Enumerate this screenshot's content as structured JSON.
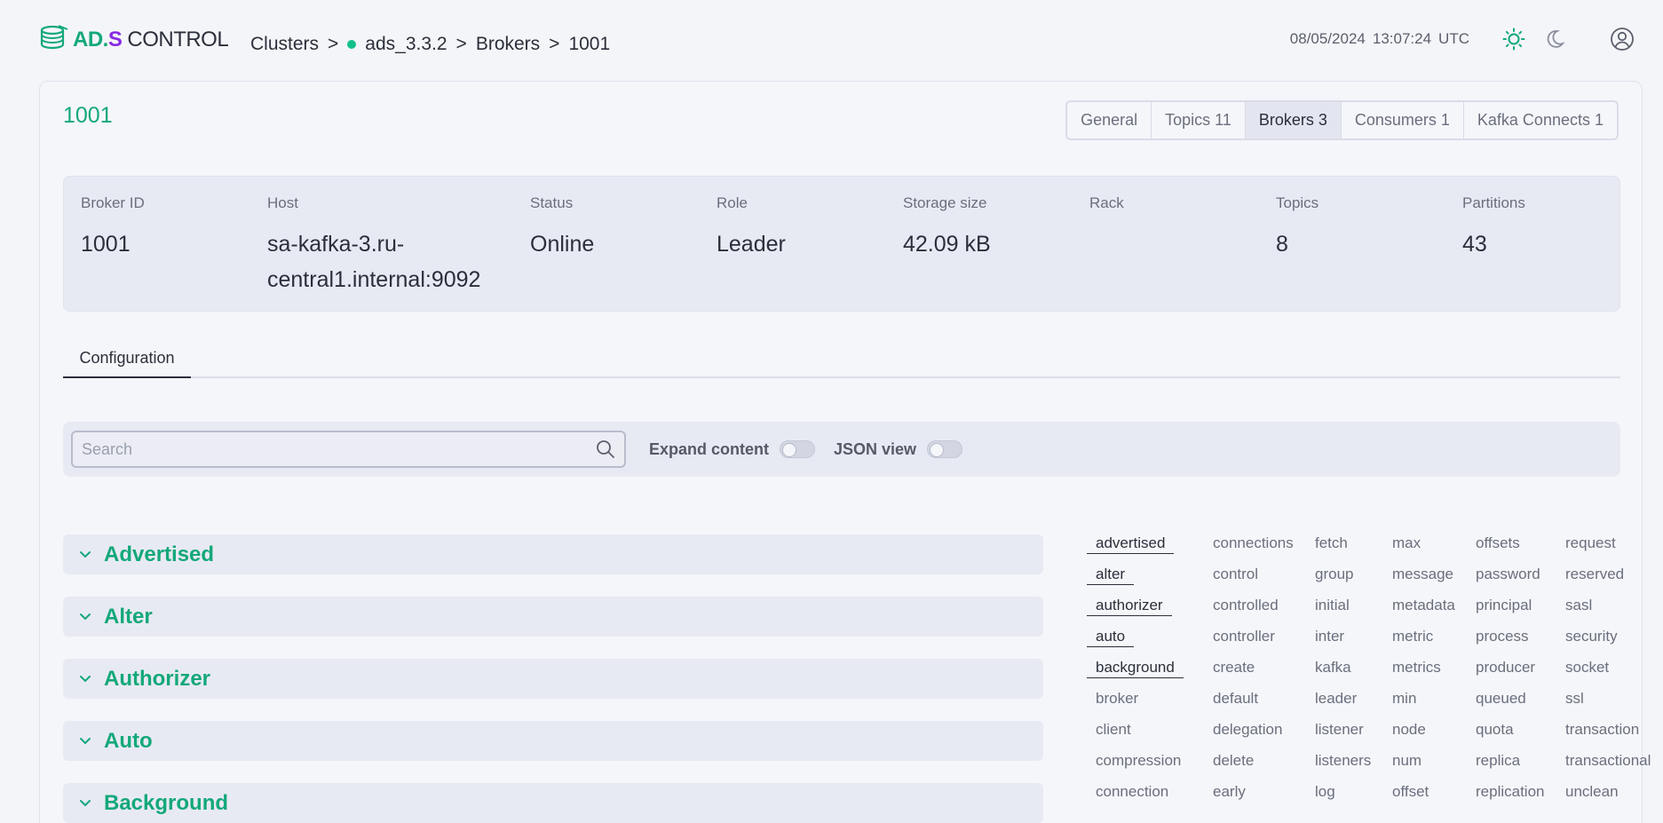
{
  "brand": {
    "part1": "AD.",
    "part2": "S",
    "part3": "CONTROL"
  },
  "breadcrumb": {
    "items": [
      "Clusters",
      "ads_3.3.2",
      "Brokers",
      "1001"
    ],
    "separator": ">"
  },
  "header": {
    "date": "08/05/2024",
    "time": "13:07:24",
    "timezone": "UTC"
  },
  "page": {
    "title": "1001"
  },
  "tabs": [
    {
      "label": "General",
      "count": ""
    },
    {
      "label": "Topics",
      "count": "11"
    },
    {
      "label": "Brokers",
      "count": "3"
    },
    {
      "label": "Consumers",
      "count": "1"
    },
    {
      "label": "Kafka Connects",
      "count": "1"
    }
  ],
  "broker": {
    "broker_id": {
      "label": "Broker ID",
      "value": "1001"
    },
    "host": {
      "label": "Host",
      "value_line1": "sa-kafka-3.ru-",
      "value_line2": "central1.internal:9092"
    },
    "status": {
      "label": "Status",
      "value": "Online"
    },
    "role": {
      "label": "Role",
      "value": "Leader"
    },
    "storage": {
      "label": "Storage size",
      "value": "42.09 kB"
    },
    "rack": {
      "label": "Rack",
      "value": ""
    },
    "topics": {
      "label": "Topics",
      "value": "8"
    },
    "partitions": {
      "label": "Partitions",
      "value": "43"
    }
  },
  "section_tab": "Configuration",
  "toolbar": {
    "search_placeholder": "Search",
    "expand_label": "Expand content",
    "json_label": "JSON view"
  },
  "groups": [
    "Advertised",
    "Alter",
    "Authorizer",
    "Auto",
    "Background"
  ],
  "keywords": [
    [
      "advertised",
      "alter",
      "authorizer",
      "auto",
      "background",
      "broker",
      "client",
      "compression",
      "connection"
    ],
    [
      "connections",
      "control",
      "controlled",
      "controller",
      "create",
      "default",
      "delegation",
      "delete",
      "early"
    ],
    [
      "fetch",
      "group",
      "initial",
      "inter",
      "kafka",
      "leader",
      "listener",
      "listeners",
      "log"
    ],
    [
      "max",
      "message",
      "metadata",
      "metric",
      "metrics",
      "min",
      "node",
      "num",
      "offset"
    ],
    [
      "offsets",
      "password",
      "principal",
      "process",
      "producer",
      "queued",
      "quota",
      "replica",
      "replication"
    ],
    [
      "request",
      "reserved",
      "sasl",
      "security",
      "socket",
      "ssl",
      "transaction",
      "transactional",
      "unclean"
    ]
  ],
  "selected_keywords": [
    "advertised",
    "alter",
    "authorizer",
    "auto",
    "background"
  ],
  "colors": {
    "accent": "#14a87a",
    "brand_purple": "#8a2be2"
  }
}
